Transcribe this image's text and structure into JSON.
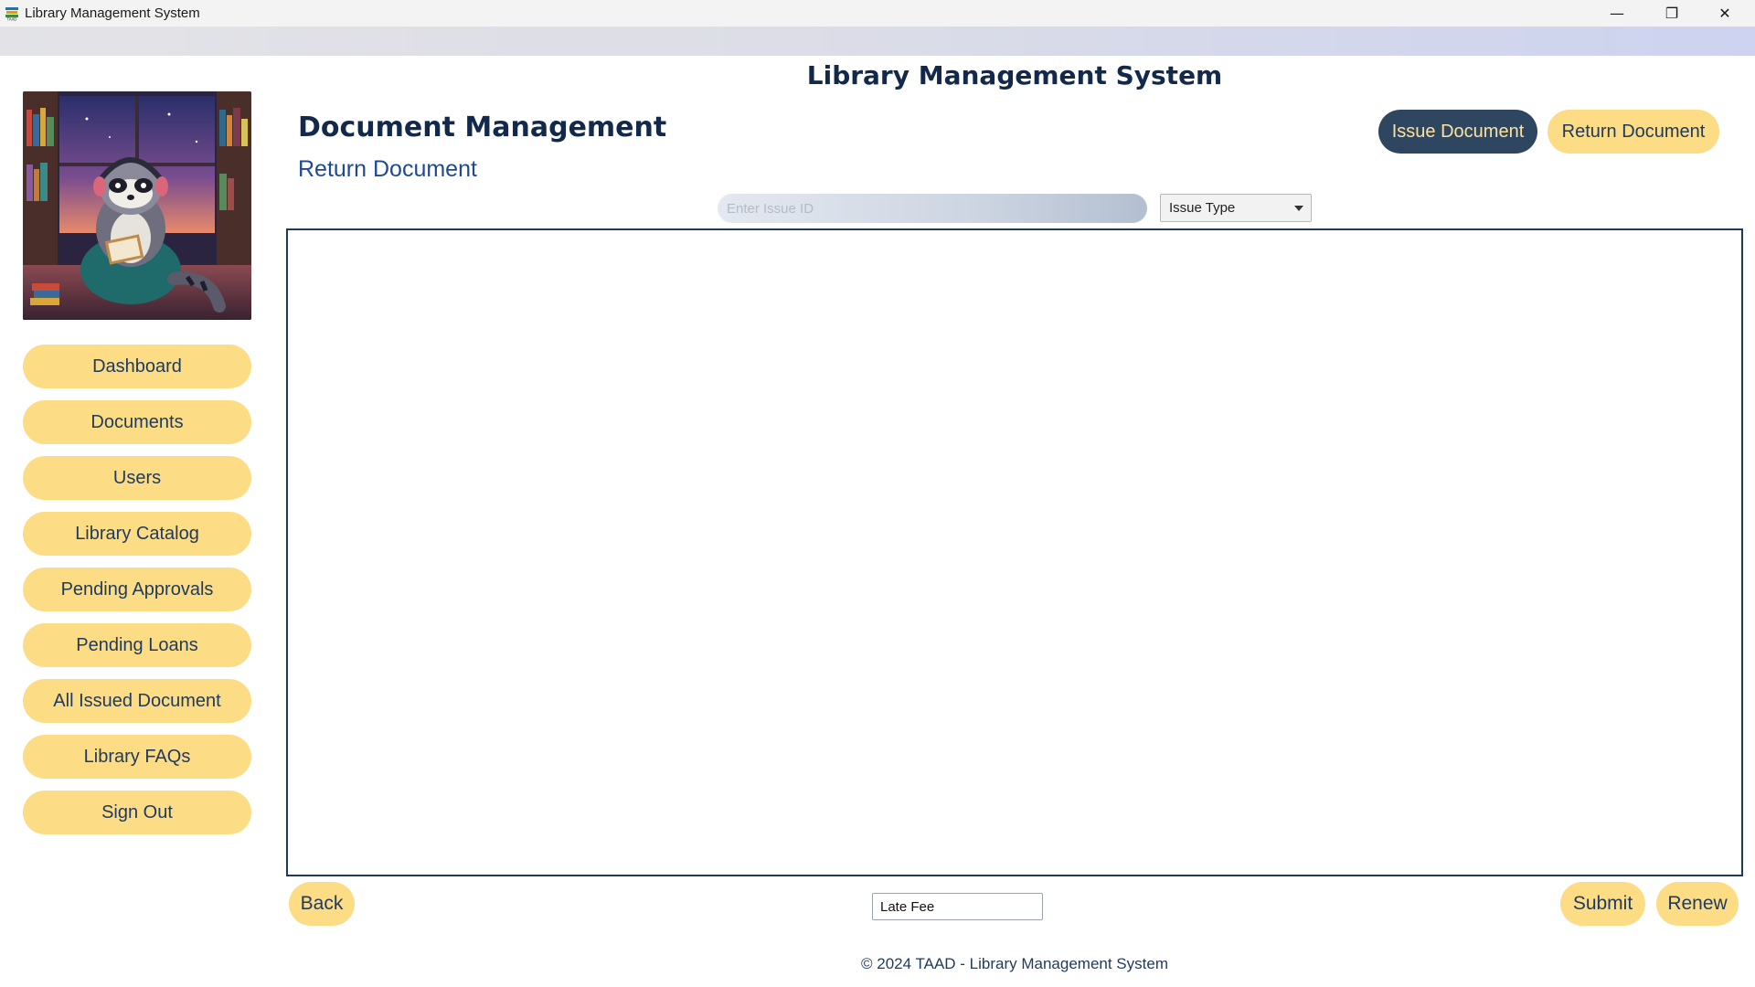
{
  "window": {
    "title": "Library Management System",
    "controls": {
      "minimize": "—",
      "maximize": "❐",
      "close": "✕"
    }
  },
  "app": {
    "main_title": "Library Management System",
    "hero_image_desc_icon": "raccoon-reading-illustration"
  },
  "sidebar": {
    "items": [
      {
        "label": "Dashboard"
      },
      {
        "label": "Documents"
      },
      {
        "label": "Users"
      },
      {
        "label": "Library Catalog"
      },
      {
        "label": "Pending Approvals"
      },
      {
        "label": "Pending Loans"
      },
      {
        "label": "All Issued Document"
      },
      {
        "label": "Library FAQs"
      },
      {
        "label": "Sign Out"
      }
    ]
  },
  "header": {
    "section_title": "Document Management",
    "subtitle": "Return Document",
    "issue_button": "Issue Document",
    "return_button": "Return Document"
  },
  "filters": {
    "issue_id_placeholder": "Enter Issue ID",
    "issue_type_selected": "Issue Type"
  },
  "bottom": {
    "back": "Back",
    "late_fee_value": "Late Fee",
    "submit": "Submit",
    "renew": "Renew"
  },
  "footer": {
    "text": "© 2024 TAAD - Library Management System"
  },
  "colors": {
    "accent_yellow": "#fddc86",
    "navy": "#13294b",
    "dark_pill": "#2f4660"
  }
}
